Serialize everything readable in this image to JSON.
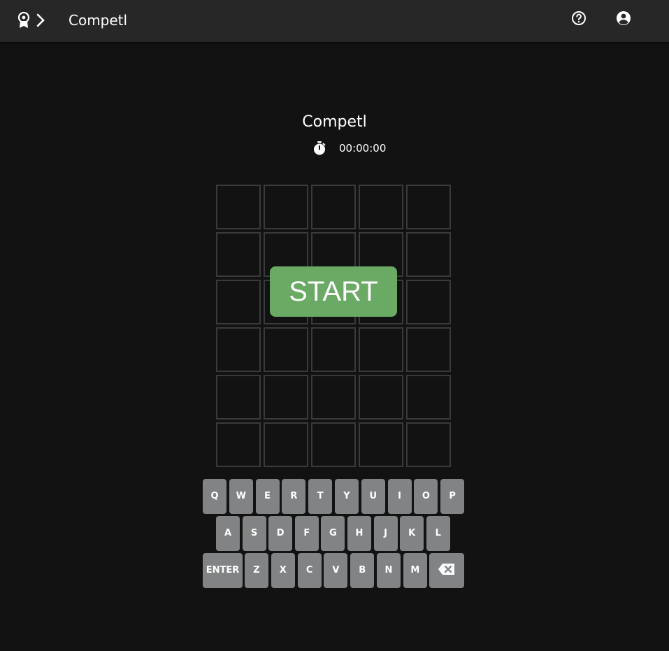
{
  "header": {
    "title": "Competl",
    "icons": {
      "award": "award-icon",
      "chevron": "chevron-right-icon",
      "help": "help-circle-icon",
      "account": "account-circle-icon"
    }
  },
  "game": {
    "title": "Competl",
    "timer": "00:00:00",
    "start_label": "START",
    "rows": 6,
    "columns": 5
  },
  "keyboard": {
    "row1": [
      "Q",
      "W",
      "E",
      "R",
      "T",
      "Y",
      "U",
      "I",
      "O",
      "P"
    ],
    "row2": [
      "A",
      "S",
      "D",
      "F",
      "G",
      "H",
      "J",
      "K",
      "L"
    ],
    "row3": [
      "ENTER",
      "Z",
      "X",
      "C",
      "V",
      "B",
      "N",
      "M"
    ],
    "backspace_icon": "backspace-icon"
  },
  "colors": {
    "background": "#121212",
    "header": "#272727",
    "tile_border": "#3a3a3c",
    "key": "#818384",
    "start": "#6aaa64"
  }
}
